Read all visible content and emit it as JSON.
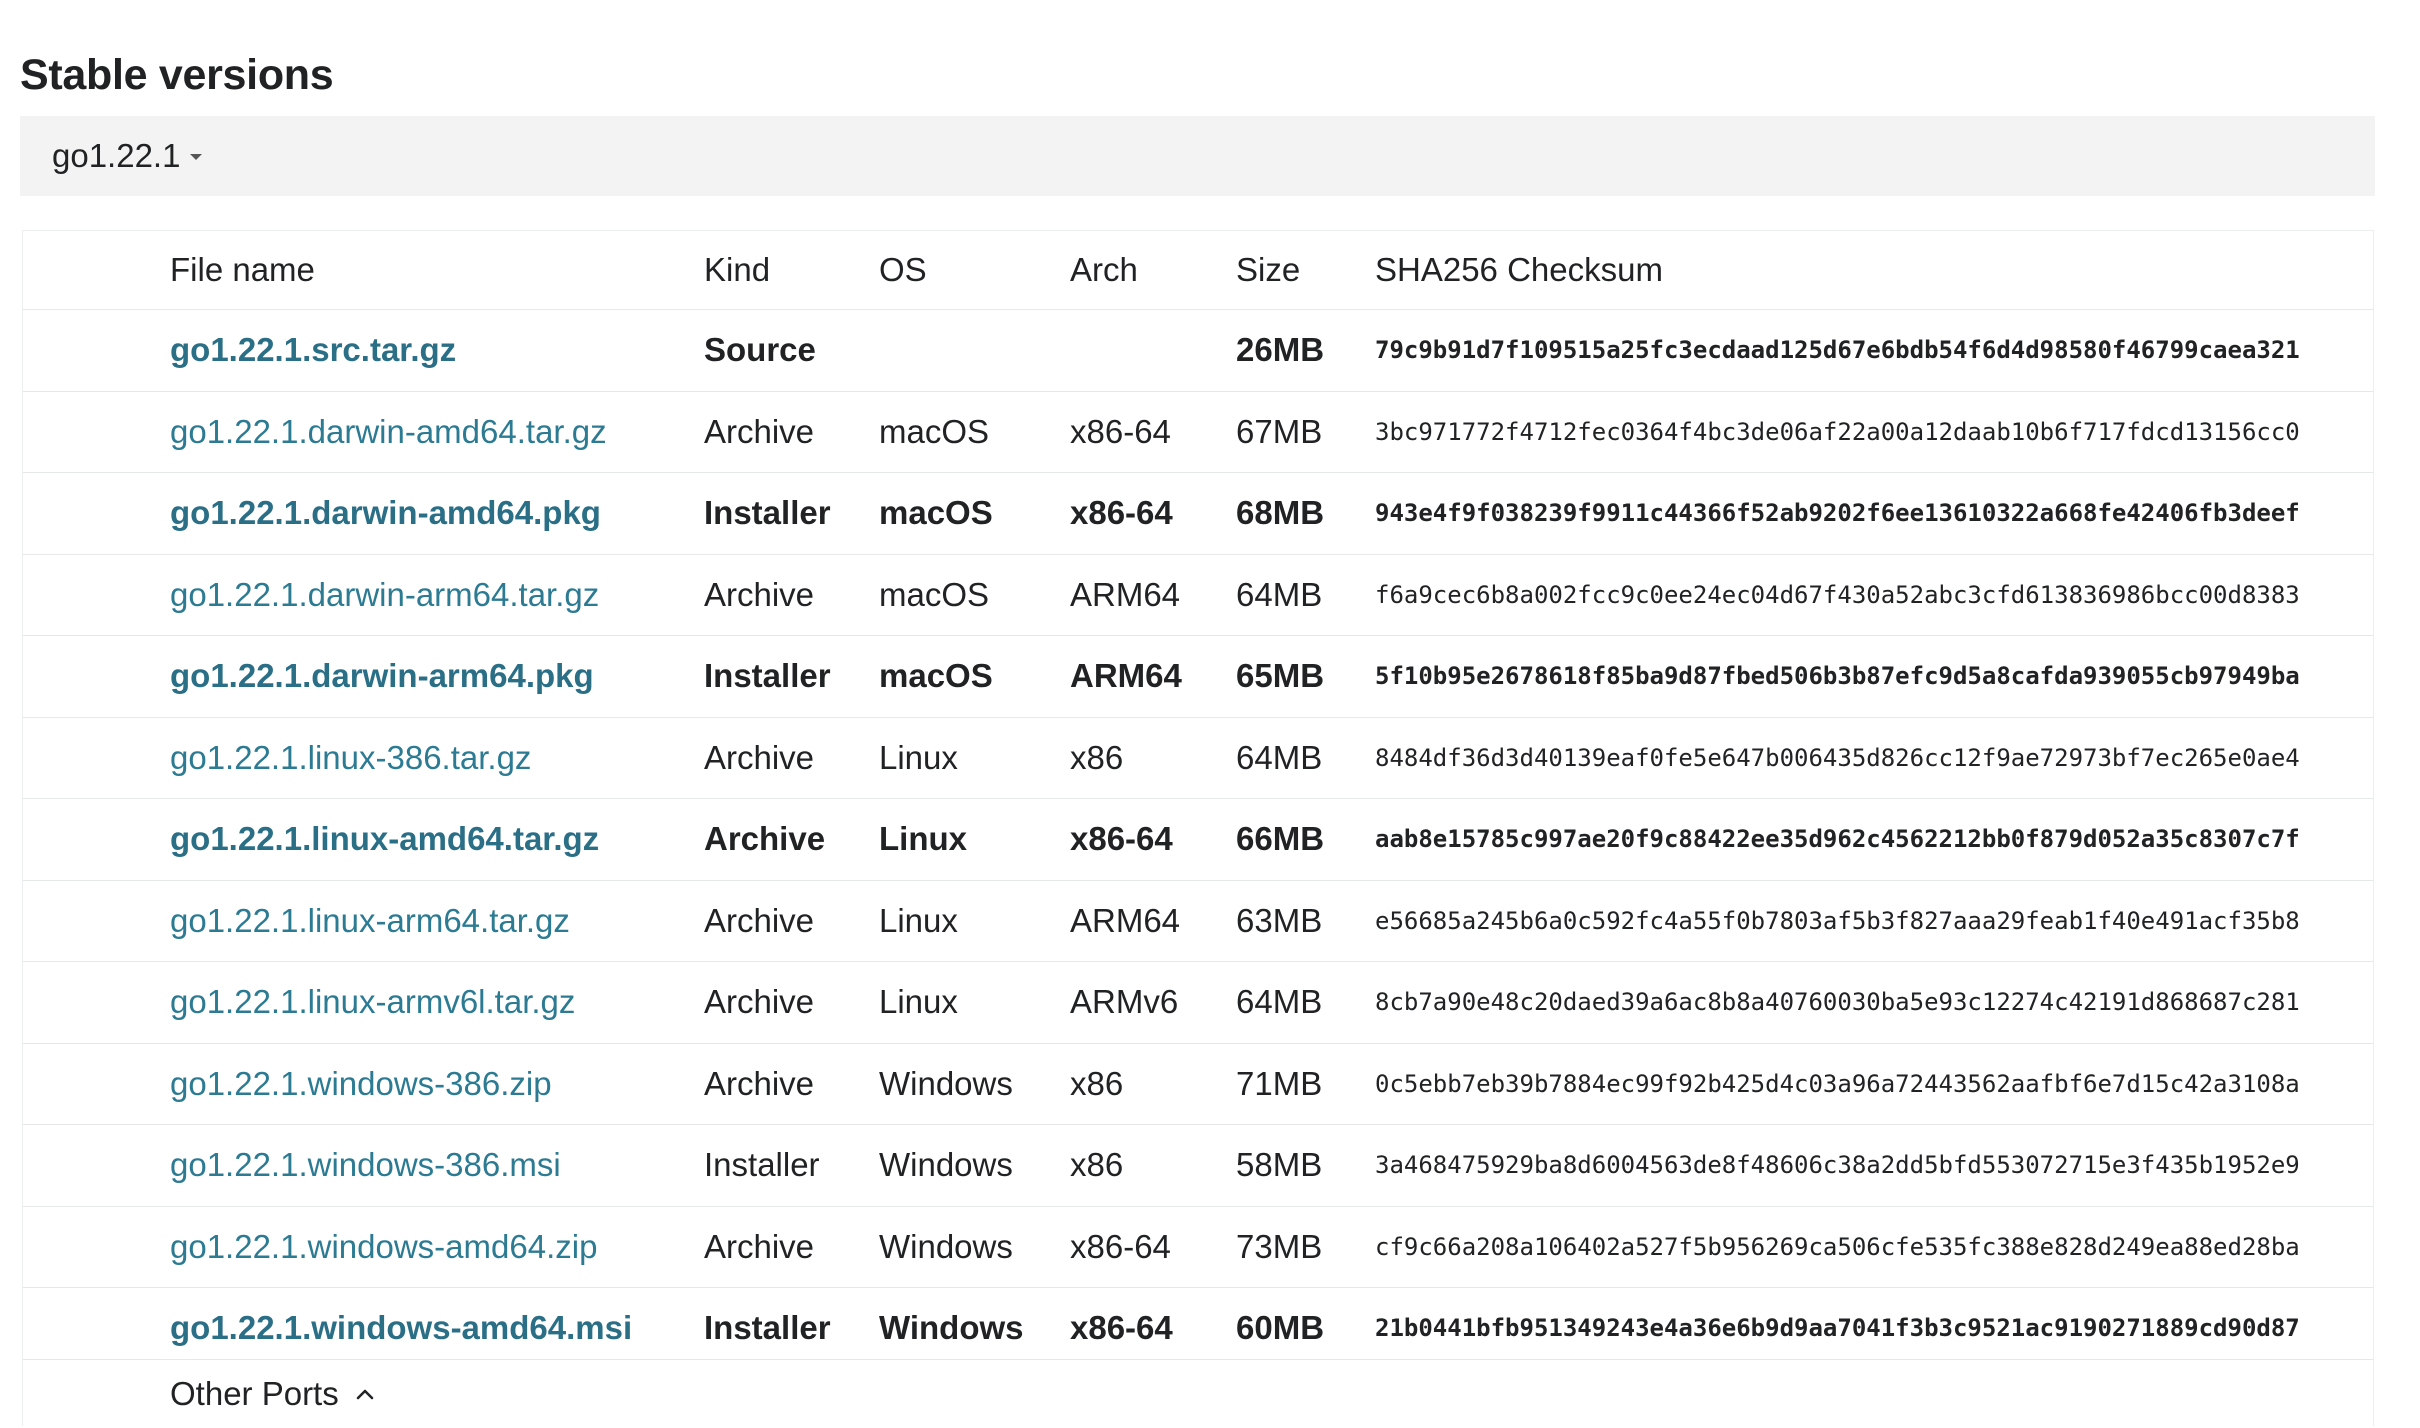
{
  "page": {
    "heading": "Stable versions"
  },
  "version_selector": {
    "selected": "go1.22.1"
  },
  "table": {
    "headers": {
      "file": "File name",
      "kind": "Kind",
      "os": "OS",
      "arch": "Arch",
      "size": "Size",
      "checksum": "SHA256 Checksum"
    },
    "rows": [
      {
        "file": "go1.22.1.src.tar.gz",
        "kind": "Source",
        "os": "",
        "arch": "",
        "size": "26MB",
        "checksum": "79c9b91d7f109515a25fc3ecdaad125d67e6bdb54f6d4d98580f46799caea321",
        "featured": true
      },
      {
        "file": "go1.22.1.darwin-amd64.tar.gz",
        "kind": "Archive",
        "os": "macOS",
        "arch": "x86-64",
        "size": "67MB",
        "checksum": "3bc971772f4712fec0364f4bc3de06af22a00a12daab10b6f717fdcd13156cc0",
        "featured": false
      },
      {
        "file": "go1.22.1.darwin-amd64.pkg",
        "kind": "Installer",
        "os": "macOS",
        "arch": "x86-64",
        "size": "68MB",
        "checksum": "943e4f9f038239f9911c44366f52ab9202f6ee13610322a668fe42406fb3deef",
        "featured": true
      },
      {
        "file": "go1.22.1.darwin-arm64.tar.gz",
        "kind": "Archive",
        "os": "macOS",
        "arch": "ARM64",
        "size": "64MB",
        "checksum": "f6a9cec6b8a002fcc9c0ee24ec04d67f430a52abc3cfd613836986bcc00d8383",
        "featured": false
      },
      {
        "file": "go1.22.1.darwin-arm64.pkg",
        "kind": "Installer",
        "os": "macOS",
        "arch": "ARM64",
        "size": "65MB",
        "checksum": "5f10b95e2678618f85ba9d87fbed506b3b87efc9d5a8cafda939055cb97949ba",
        "featured": true
      },
      {
        "file": "go1.22.1.linux-386.tar.gz",
        "kind": "Archive",
        "os": "Linux",
        "arch": "x86",
        "size": "64MB",
        "checksum": "8484df36d3d40139eaf0fe5e647b006435d826cc12f9ae72973bf7ec265e0ae4",
        "featured": false
      },
      {
        "file": "go1.22.1.linux-amd64.tar.gz",
        "kind": "Archive",
        "os": "Linux",
        "arch": "x86-64",
        "size": "66MB",
        "checksum": "aab8e15785c997ae20f9c88422ee35d962c4562212bb0f879d052a35c8307c7f",
        "featured": true
      },
      {
        "file": "go1.22.1.linux-arm64.tar.gz",
        "kind": "Archive",
        "os": "Linux",
        "arch": "ARM64",
        "size": "63MB",
        "checksum": "e56685a245b6a0c592fc4a55f0b7803af5b3f827aaa29feab1f40e491acf35b8",
        "featured": false
      },
      {
        "file": "go1.22.1.linux-armv6l.tar.gz",
        "kind": "Archive",
        "os": "Linux",
        "arch": "ARMv6",
        "size": "64MB",
        "checksum": "8cb7a90e48c20daed39a6ac8b8a40760030ba5e93c12274c42191d868687c281",
        "featured": false
      },
      {
        "file": "go1.22.1.windows-386.zip",
        "kind": "Archive",
        "os": "Windows",
        "arch": "x86",
        "size": "71MB",
        "checksum": "0c5ebb7eb39b7884ec99f92b425d4c03a96a72443562aafbf6e7d15c42a3108a",
        "featured": false
      },
      {
        "file": "go1.22.1.windows-386.msi",
        "kind": "Installer",
        "os": "Windows",
        "arch": "x86",
        "size": "58MB",
        "checksum": "3a468475929ba8d6004563de8f48606c38a2dd5bfd553072715e3f435b1952e9",
        "featured": false
      },
      {
        "file": "go1.22.1.windows-amd64.zip",
        "kind": "Archive",
        "os": "Windows",
        "arch": "x86-64",
        "size": "73MB",
        "checksum": "cf9c66a208a106402a527f5b956269ca506cfe535fc388e828d249ea88ed28ba",
        "featured": false
      },
      {
        "file": "go1.22.1.windows-amd64.msi",
        "kind": "Installer",
        "os": "Windows",
        "arch": "x86-64",
        "size": "60MB",
        "checksum": "21b0441bfb951349243e4a36e6b9d9aa7041f3b3c9521ac9190271889cd90d87",
        "featured": true
      }
    ]
  },
  "other_ports": {
    "label": "Other Ports",
    "icon": "chevron-up-icon"
  }
}
